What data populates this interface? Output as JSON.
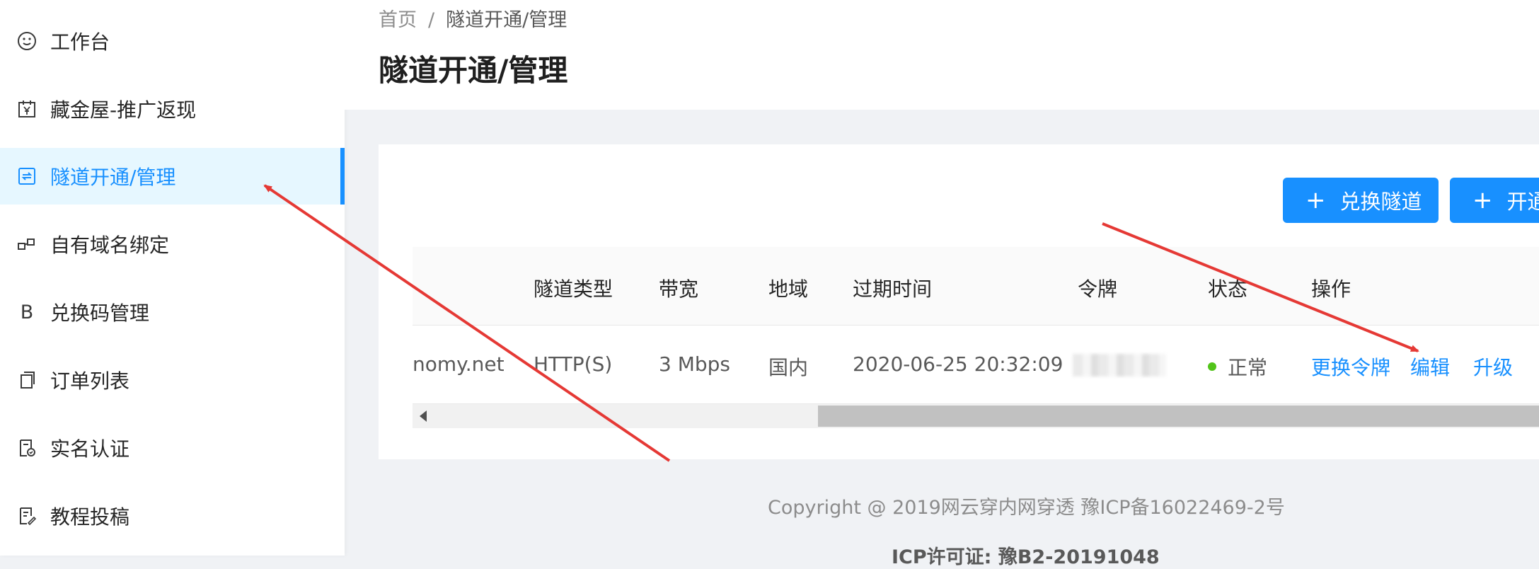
{
  "sidebar": {
    "items": [
      {
        "label": "工作台",
        "icon": "smile-icon"
      },
      {
        "label": "藏金屋-推广返现",
        "icon": "calendar-yen-icon"
      },
      {
        "label": "隧道开通/管理",
        "icon": "sync-box-icon",
        "active": true
      },
      {
        "label": "自有域名绑定",
        "icon": "domain-link-icon"
      },
      {
        "label": "兑换码管理",
        "icon": "letter-b-icon"
      },
      {
        "label": "订单列表",
        "icon": "copy-doc-icon"
      },
      {
        "label": "实名认证",
        "icon": "doc-check-icon"
      },
      {
        "label": "教程投稿",
        "icon": "doc-edit-icon"
      }
    ]
  },
  "header": {
    "breadcrumb_home": "首页",
    "breadcrumb_sep": "/",
    "breadcrumb_current": "隧道开通/管理",
    "title": "隧道开通/管理"
  },
  "toolbar": {
    "redeem_label": "兑换隧道",
    "open_label": "开通"
  },
  "table": {
    "columns": [
      "隧道类型",
      "带宽",
      "地域",
      "过期时间",
      "令牌",
      "状态",
      "操作"
    ],
    "row": {
      "domain": "nomy.net",
      "type": "HTTP(S)",
      "bandwidth": "3 Mbps",
      "region": "国内",
      "expire": "2020-06-25 20:32:09",
      "status": "正常",
      "actions": [
        "更换令牌",
        "编辑",
        "升级"
      ]
    }
  },
  "footer": {
    "copyright": "Copyright @ 2019网云穿内网穿透 豫ICP备16022469-2号",
    "license": "ICP许可证: 豫B2-20191048"
  },
  "colors": {
    "primary": "#1890ff",
    "active_bg": "#e6f7ff",
    "status_green": "#52c41a",
    "annotation_red": "#e53935"
  }
}
